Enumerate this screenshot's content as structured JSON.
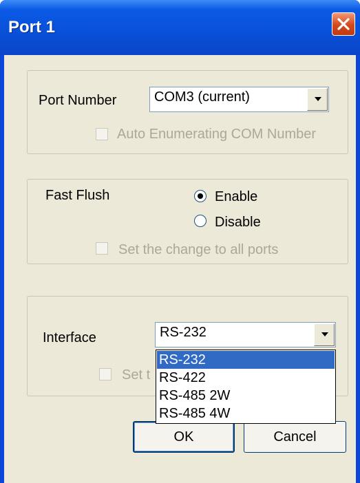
{
  "window": {
    "title": "Port 1"
  },
  "port_group": {
    "label": "Port Number",
    "combo_value": "COM3 (current)",
    "auto_enum_label": "Auto Enumerating COM Number"
  },
  "flush_group": {
    "label": "Fast Flush",
    "enable_label": "Enable",
    "disable_label": "Disable",
    "selected": "Enable",
    "set_all_label": "Set the change to all ports"
  },
  "interface_group": {
    "label": "Interface",
    "combo_value": "RS-232",
    "set_all_label_partial": "Set t",
    "options": [
      "RS-232",
      "RS-422",
      "RS-485 2W",
      "RS-485 4W"
    ],
    "highlighted": "RS-232"
  },
  "buttons": {
    "ok": "OK",
    "cancel": "Cancel"
  },
  "colors": {
    "title_blue": "#0a5ae6",
    "dialog_bg": "#ece9d8",
    "selection": "#316ac5",
    "close_red": "#d4481c"
  }
}
